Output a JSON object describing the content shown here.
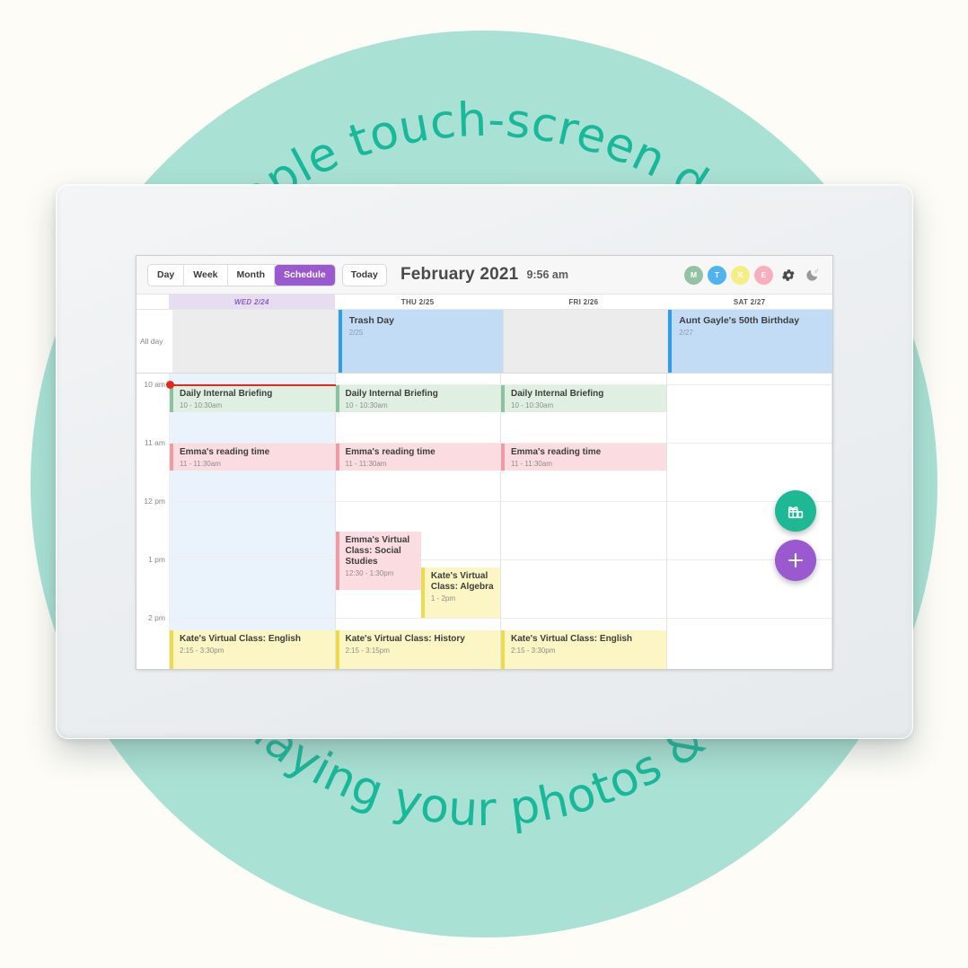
{
  "promo": {
    "top_text": "A simple touch-screen device",
    "bottom_text": "for displaying your photos & events.",
    "text_color": "#18b89a",
    "circle_color": "#a9e1d4",
    "page_background": "#fdfcf7"
  },
  "toolbar": {
    "views": [
      {
        "label": "Day",
        "active": false
      },
      {
        "label": "Week",
        "active": false
      },
      {
        "label": "Month",
        "active": false
      },
      {
        "label": "Schedule",
        "active": true
      }
    ],
    "today_label": "Today",
    "title": "February 2021",
    "clock": "9:56 am",
    "active_color": "#9b59d0",
    "avatars": [
      {
        "initial": "M",
        "color": "#93c3a4"
      },
      {
        "initial": "T",
        "color": "#4fb3f0"
      },
      {
        "initial": "K",
        "color": "#f4ee85"
      },
      {
        "initial": "E",
        "color": "#f8aebd"
      }
    ],
    "settings_icon": "gear-icon",
    "sleep_icon": "moon-sleep-icon"
  },
  "calendar": {
    "allday_label": "All day",
    "days": [
      {
        "label": "WED 2/24",
        "today": true
      },
      {
        "label": "THU 2/25",
        "today": false
      },
      {
        "label": "FRI 2/26",
        "today": false
      },
      {
        "label": "SAT 2/27",
        "today": false
      }
    ],
    "time_labels": [
      "10 am",
      "11 am",
      "12 pm",
      "1 pm",
      "2 pm"
    ],
    "allday_events": [
      {
        "col": 1,
        "title": "Trash Day",
        "sub": "2/25"
      },
      {
        "col": 3,
        "title": "Aunt Gayle's 50th Birthday",
        "sub": "2/27"
      }
    ],
    "events": [
      {
        "col": 0,
        "title": "Daily Internal Briefing",
        "time": "10 - 10:30am",
        "color": "green"
      },
      {
        "col": 1,
        "title": "Daily Internal Briefing",
        "time": "10 - 10:30am",
        "color": "green"
      },
      {
        "col": 2,
        "title": "Daily Internal Briefing",
        "time": "10 - 10:30am",
        "color": "green"
      },
      {
        "col": 0,
        "title": "Emma's reading time",
        "time": "11 - 11:30am",
        "color": "pink"
      },
      {
        "col": 1,
        "title": "Emma's reading time",
        "time": "11 - 11:30am",
        "color": "pink"
      },
      {
        "col": 2,
        "title": "Emma's reading time",
        "time": "11 - 11:30am",
        "color": "pink"
      },
      {
        "col": 1,
        "title": "Emma's Virtual Class: Social Studies",
        "time": "12:30 - 1:30pm",
        "color": "pink"
      },
      {
        "col": 1,
        "title": "Kate's Virtual Class: Algebra",
        "time": "1 - 2pm",
        "color": "yellow"
      },
      {
        "col": 0,
        "title": "Kate's Virtual Class: English",
        "time": "2:15 - 3:30pm",
        "color": "yellow"
      },
      {
        "col": 1,
        "title": "Kate's Virtual Class: History",
        "time": "2:15 - 3:15pm",
        "color": "yellow"
      },
      {
        "col": 2,
        "title": "Kate's Virtual Class: English",
        "time": "2:15 - 3:30pm",
        "color": "yellow"
      }
    ],
    "current_time_indicator": "10:00 am",
    "fab_photos_icon": "gift-photos-icon",
    "fab_add_icon": "plus-icon",
    "fab_photos_color": "#1fb894",
    "fab_add_color": "#9b59d0"
  }
}
